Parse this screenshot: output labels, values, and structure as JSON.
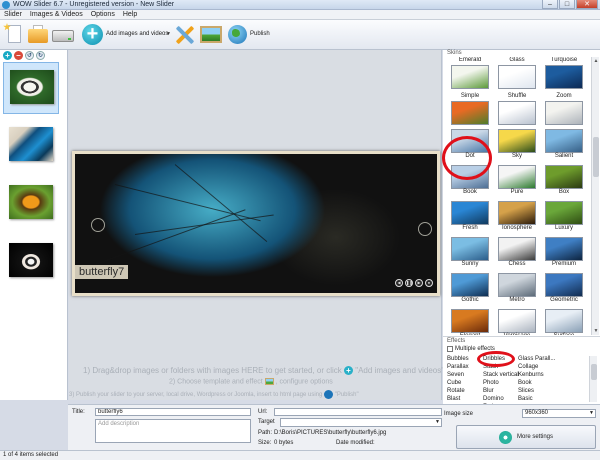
{
  "window": {
    "title": "WOW Slider 6.7 - Unregistered version - New Slider",
    "minimize": "–",
    "maximize": "□",
    "close": "✕"
  },
  "menu": [
    "Slider",
    "Images & Videos",
    "Options",
    "Help"
  ],
  "toolbar": {
    "add_label": "Add images and videos",
    "add_dropdown": "▼",
    "publish_label": "Publish"
  },
  "icons": {
    "new": "new-file-icon",
    "open": "open-folder-icon",
    "save": "save-drive-icon",
    "add": "add-plus-icon",
    "tools": "tools-icon",
    "image": "image-icon",
    "publish": "globe-icon"
  },
  "thumbs_tools": [
    "+",
    "–",
    "↺",
    "↻"
  ],
  "preview": {
    "caption": "butterfly7",
    "dots": [
      "◀",
      "❚❚",
      "▶",
      "●"
    ],
    "hint1_pre": "1) Drag&drop images or folders with images HERE to get started, or click",
    "hint1_post": "\"Add images and videos\"",
    "hint2_pre": "2) Choose template and effect",
    "hint2_post": ", configure options",
    "hint3_pre": "3) Publish your slider to your server, local drive, Wordpress or Joomla, insert to html page using",
    "hint3_post": "\"Publish\""
  },
  "skins": {
    "label": "Skins",
    "items": [
      {
        "name": "Emerald",
        "c1": "#f3f6ee",
        "c2": "#5c9a3a"
      },
      {
        "name": "Glass",
        "c1": "#ffffff",
        "c2": "#dfe6ef"
      },
      {
        "name": "Turquoise",
        "c1": "#1d5c9e",
        "c2": "#0c2a55"
      },
      {
        "name": "Simple",
        "c1": "#e86a24",
        "c2": "#4e7d2a"
      },
      {
        "name": "Shuffle",
        "c1": "#ffffff",
        "c2": "#b9c2cf"
      },
      {
        "name": "Zoom",
        "c1": "#f3f3ef",
        "c2": "#adb3ba"
      },
      {
        "name": "Dot",
        "c1": "#c9d8e7",
        "c2": "#4a78a8"
      },
      {
        "name": "Sky",
        "c1": "#f6d84a",
        "c2": "#2a4c1a"
      },
      {
        "name": "Salient",
        "c1": "#7fb9e3",
        "c2": "#365f86"
      },
      {
        "name": "Book",
        "c1": "#b9cfe6",
        "c2": "#4d6e94"
      },
      {
        "name": "Pure",
        "c1": "#f5f5f5",
        "c2": "#2c7a2e"
      },
      {
        "name": "Box",
        "c1": "#6e9c2c",
        "c2": "#2b3a12"
      },
      {
        "name": "Fresh",
        "c1": "#2a86d4",
        "c2": "#103a5e"
      },
      {
        "name": "Ionosphere",
        "c1": "#d5a14a",
        "c2": "#2a1a0a"
      },
      {
        "name": "Luxury",
        "c1": "#6aa73a",
        "c2": "#2f4d12"
      },
      {
        "name": "Sunny",
        "c1": "#7bbde3",
        "c2": "#2b5d8a"
      },
      {
        "name": "Chess",
        "c1": "#f2f2f2",
        "c2": "#3a3a3a"
      },
      {
        "name": "Premium",
        "c1": "#3f7fc4",
        "c2": "#0d2440"
      },
      {
        "name": "Gothic",
        "c1": "#4f9ad6",
        "c2": "#0e2d52"
      },
      {
        "name": "Metro",
        "c1": "#cfd6dd",
        "c2": "#5c6a78"
      },
      {
        "name": "Geometric",
        "c1": "#3c78c0",
        "c2": "#112c50"
      },
      {
        "name": "Elegant",
        "c1": "#d87a20",
        "c2": "#6a2a0a"
      },
      {
        "name": "Vernisage",
        "c1": "#ffffff",
        "c2": "#aab3bf"
      },
      {
        "name": "Surface",
        "c1": "#e7eef5",
        "c2": "#8aa0b6"
      }
    ]
  },
  "effects": {
    "label": "Effects",
    "multiple_label": "Multiple effects",
    "col1": [
      "Bubbles",
      "Parallax",
      "Seven",
      "Cube",
      "Rotate",
      "Blast"
    ],
    "col2": [
      "Dribbles",
      "Stack",
      "Stack vertical",
      "Photo",
      "Blur",
      "Domino",
      "Fade"
    ],
    "col3": [
      "Glass Parall...",
      "Collage",
      "Kenburns",
      "Book",
      "Slices",
      "Basic"
    ]
  },
  "properties": {
    "title_label": "Title:",
    "title_value": "butterfly6",
    "desc_placeholder": "Add description",
    "url_label": "Url:",
    "url_value": "",
    "target_label": "Target",
    "target_value": "",
    "path_label": "Path:",
    "path_value": "D:\\Boris\\PICTURES\\butterfly\\butterfly6.jpg",
    "size_label": "Size:",
    "size_value": "0 bytes",
    "modified_label": "Date modified:",
    "modified_value": "",
    "imagesize_label": "Image size",
    "imagesize_value": "960x360",
    "more_settings": "More settings"
  },
  "status": {
    "text": "1 of 4 items selected"
  }
}
